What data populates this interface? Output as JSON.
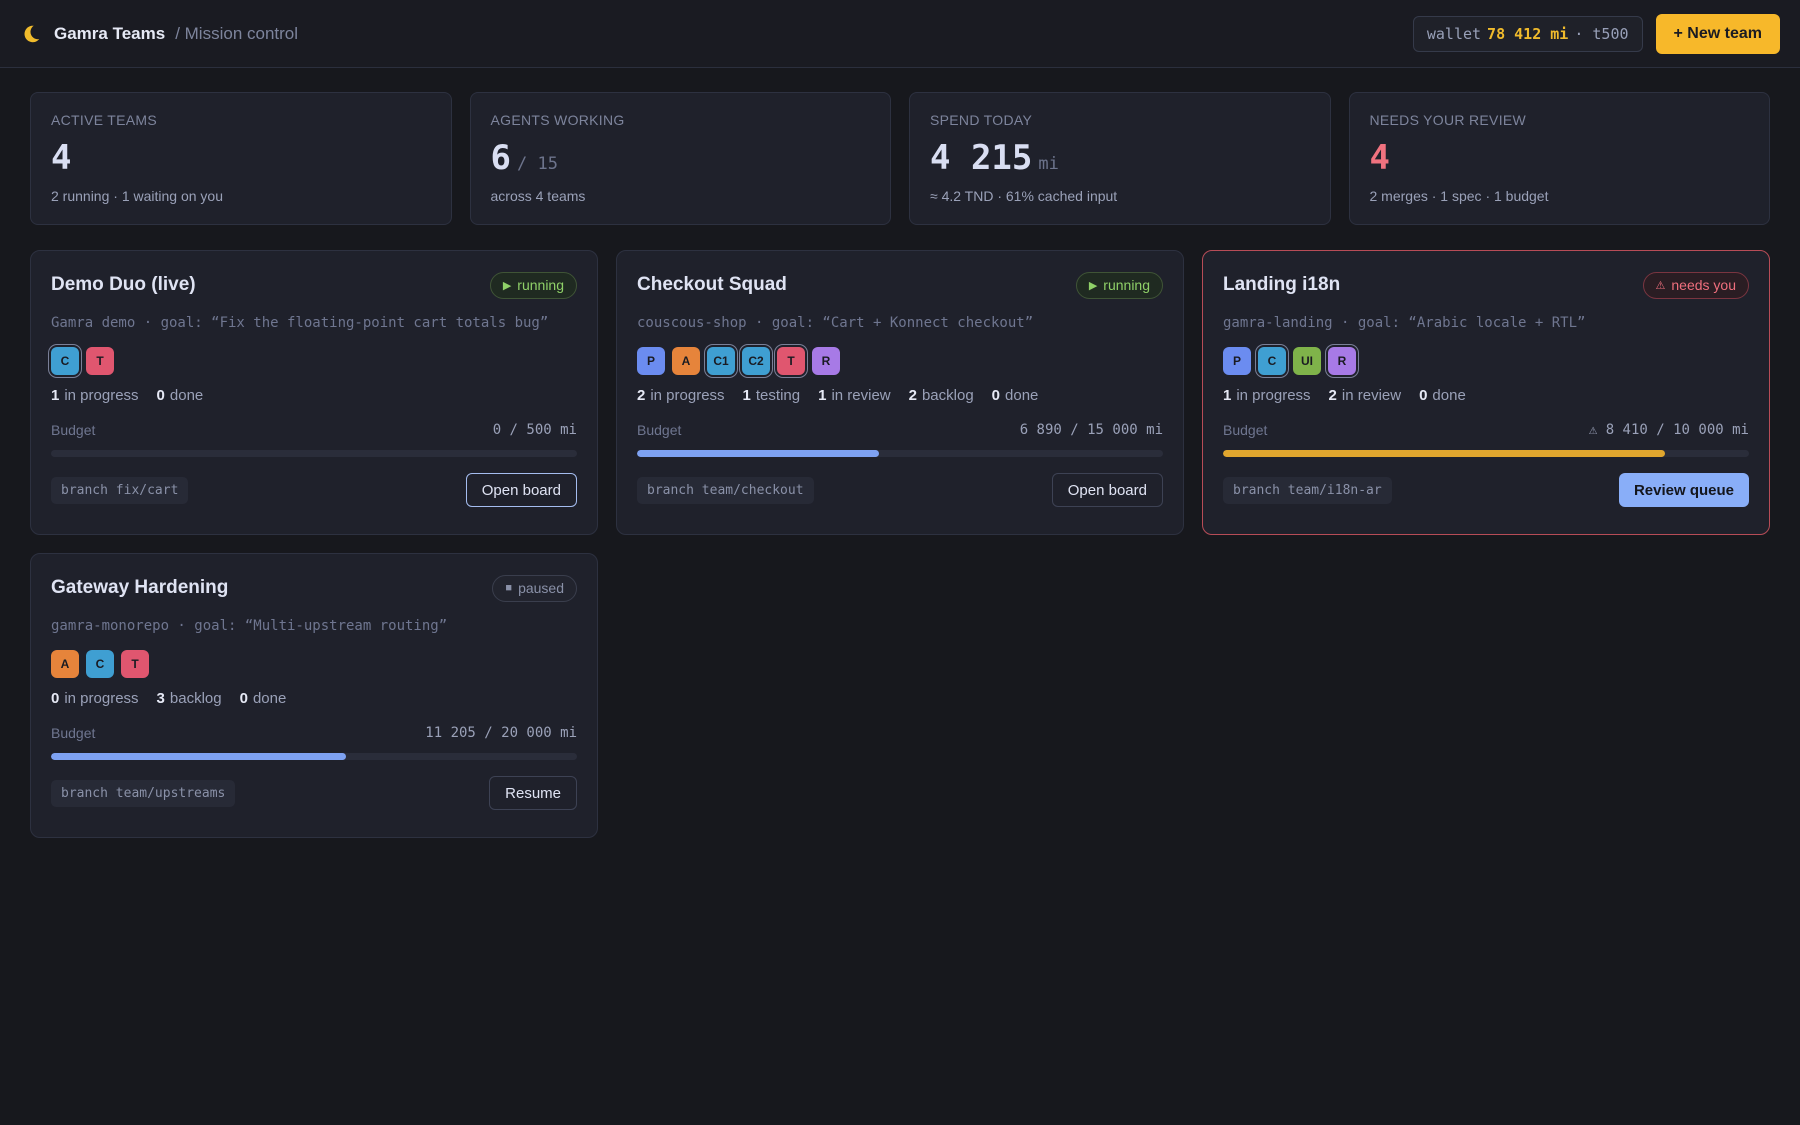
{
  "header": {
    "title": "Gamra Teams",
    "breadcrumb": "/ Mission control",
    "wallet_prefix": "wallet",
    "wallet_amount": "78 412 mi",
    "wallet_suffix": "· t500",
    "new_team_label": "+ New team"
  },
  "stats": [
    {
      "label": "ACTIVE TEAMS",
      "value": "4",
      "unit": "",
      "sub": "2 running · 1 waiting on you"
    },
    {
      "label": "AGENTS WORKING",
      "value": "6",
      "unit": "/ 15",
      "sub": "across 4 teams"
    },
    {
      "label": "SPEND TODAY",
      "value": "4 215",
      "unit": "mi",
      "sub": "≈ 4.2 TND · 61% cached input"
    },
    {
      "label": "NEEDS YOUR REVIEW",
      "value": "4",
      "unit": "",
      "sub": "2 merges · 1 spec · 1 budget"
    }
  ],
  "colors": {
    "accent_yellow": "#f7b82a",
    "accent_blue": "#89aef8",
    "alert_red": "#ef6f7d",
    "running_green": "#8fd068",
    "budget_blue": "#7ea2f2",
    "budget_warn": "#e0a62e"
  },
  "cards": [
    {
      "title": "Demo Duo (live)",
      "status": "running",
      "status_icon": "play-icon",
      "goal": "Gamra demo · goal: “Fix the floating-point cart totals bug”",
      "agents": [
        {
          "label": "C",
          "color": "#3f9fd2",
          "working": true
        },
        {
          "label": "T",
          "color": "#e0566f",
          "working": false
        }
      ],
      "counts": [
        {
          "n": "1",
          "label": "in progress"
        },
        {
          "n": "0",
          "label": "done"
        }
      ],
      "budget_label": "Budget",
      "budget_text": "0 / 500 mi",
      "budget_fraction": 0,
      "budget_color": "#7ea2f2",
      "branch": "branch fix/cart",
      "action": "Open board"
    },
    {
      "title": "Checkout Squad",
      "status": "running",
      "status_icon": "play-icon",
      "goal": "couscous-shop · goal: “Cart + Konnect checkout”",
      "agents": [
        {
          "label": "P",
          "color": "#6b8cf0",
          "working": false
        },
        {
          "label": "A",
          "color": "#e6843b",
          "working": false
        },
        {
          "label": "C1",
          "color": "#3f9fd2",
          "working": true
        },
        {
          "label": "C2",
          "color": "#3f9fd2",
          "working": true
        },
        {
          "label": "T",
          "color": "#e0566f",
          "working": true
        },
        {
          "label": "R",
          "color": "#a77ae6",
          "working": false
        }
      ],
      "counts": [
        {
          "n": "2",
          "label": "in progress"
        },
        {
          "n": "1",
          "label": "testing"
        },
        {
          "n": "1",
          "label": "in review"
        },
        {
          "n": "2",
          "label": "backlog"
        },
        {
          "n": "0",
          "label": "done"
        }
      ],
      "budget_label": "Budget",
      "budget_text": "6 890 / 15 000 mi",
      "budget_fraction": 0.46,
      "budget_color": "#7ea2f2",
      "branch": "branch team/checkout",
      "action": "Open board"
    },
    {
      "title": "Landing i18n",
      "status": "needs you",
      "status_icon": "warning-icon",
      "goal": "gamra-landing · goal: “Arabic locale + RTL”",
      "agents": [
        {
          "label": "P",
          "color": "#6b8cf0",
          "working": false
        },
        {
          "label": "C",
          "color": "#3f9fd2",
          "working": true
        },
        {
          "label": "UI",
          "color": "#7fb34a",
          "working": false
        },
        {
          "label": "R",
          "color": "#a77ae6",
          "working": true
        }
      ],
      "counts": [
        {
          "n": "1",
          "label": "in progress"
        },
        {
          "n": "2",
          "label": "in review"
        },
        {
          "n": "0",
          "label": "done"
        }
      ],
      "budget_label": "Budget",
      "budget_text": "⚠ 8 410 / 10 000 mi",
      "budget_fraction": 0.841,
      "budget_color": "#e0a62e",
      "branch": "branch team/i18n-ar",
      "action": "Review queue"
    },
    {
      "title": "Gateway Hardening",
      "status": "paused",
      "status_icon": "stop-icon",
      "goal": "gamra-monorepo · goal: “Multi-upstream routing”",
      "agents": [
        {
          "label": "A",
          "color": "#e6843b",
          "working": false
        },
        {
          "label": "C",
          "color": "#3f9fd2",
          "working": false
        },
        {
          "label": "T",
          "color": "#e0566f",
          "working": false
        }
      ],
      "counts": [
        {
          "n": "0",
          "label": "in progress"
        },
        {
          "n": "3",
          "label": "backlog"
        },
        {
          "n": "0",
          "label": "done"
        }
      ],
      "budget_label": "Budget",
      "budget_text": "11 205 / 20 000 mi",
      "budget_fraction": 0.56,
      "budget_color": "#7ea2f2",
      "branch": "branch team/upstreams",
      "action": "Resume"
    }
  ]
}
